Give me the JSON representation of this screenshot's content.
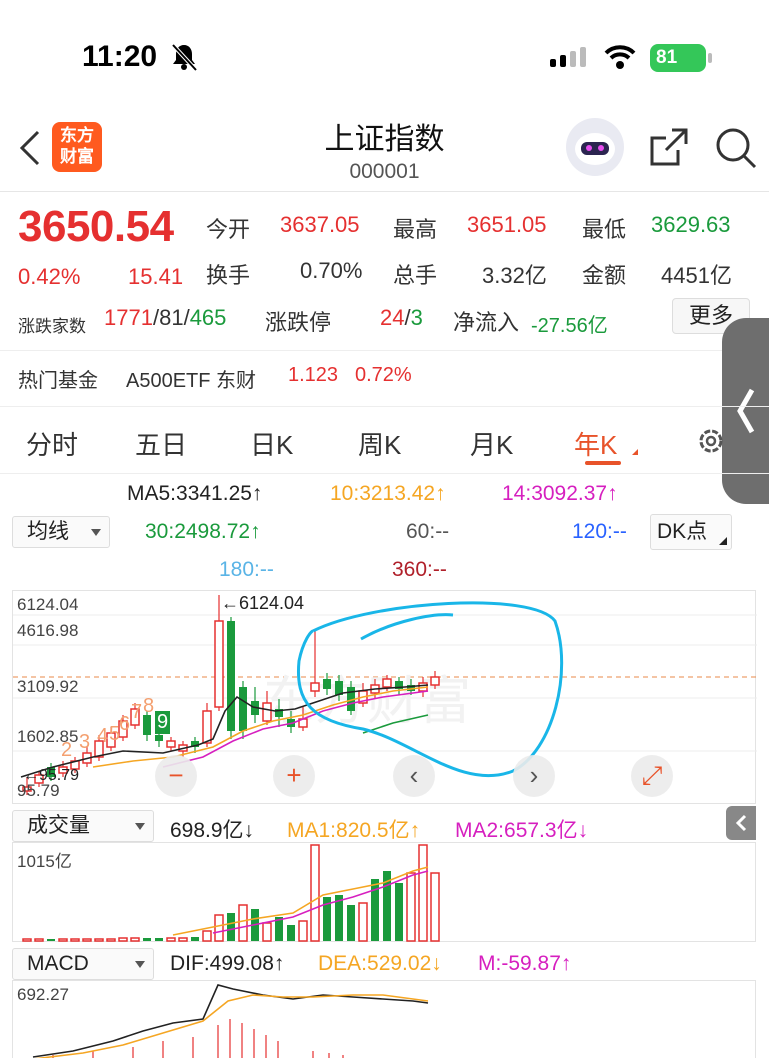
{
  "status_bar": {
    "time": "11:20",
    "battery": "81"
  },
  "nav": {
    "logo_line1": "东方",
    "logo_line2": "财富",
    "title": "上证指数",
    "code": "000001"
  },
  "quote": {
    "price": "3650.54",
    "change_pct": "0.42%",
    "change": "15.41",
    "open_label": "今开",
    "open": "3637.05",
    "high_label": "最高",
    "high": "3651.05",
    "low_label": "最低",
    "low": "3629.63",
    "turnover_label": "换手",
    "turnover": "0.70%",
    "volume_label": "总手",
    "volume": "3.32亿",
    "amount_label": "金额",
    "amount": "4451亿",
    "breadth_label": "涨跌家数",
    "breadth_up": "1771",
    "sep1": "/",
    "breadth_flat": "81",
    "sep2": "/",
    "breadth_down": "465",
    "limit_label": "涨跌停",
    "limit_up": "24",
    "sep3": "/",
    "limit_down": "3",
    "netflow_label": "净流入",
    "netflow": "-27.56亿",
    "more": "更多",
    "fund_label": "热门基金",
    "fund_name": "A500ETF 东财",
    "fund_price": "1.123",
    "fund_pct": "0.72%"
  },
  "tabs": [
    "分时",
    "五日",
    "日K",
    "周K",
    "月K",
    "年K"
  ],
  "active_tab": 5,
  "ma": {
    "ma5": "MA5:3341.25↑",
    "ma10": "10:3213.42↑",
    "ma14": "14:3092.37↑",
    "ma30": "30:2498.72↑",
    "ma60": "60:--",
    "ma120": "120:--",
    "ma180": "180:--",
    "ma360": "360:--",
    "select": "均线",
    "dk": "DK点"
  },
  "kline": {
    "y_labels": [
      "6124.04",
      "4616.98",
      "3109.92",
      "1602.85",
      "95.79"
    ],
    "max_label": "←6124.04",
    "min_label": "←95.79",
    "nine_numbers": [
      "2",
      "3",
      "4",
      "5",
      "6",
      "7",
      "8",
      "9"
    ],
    "controls": [
      "−",
      "+",
      "‹",
      "›",
      "⤢"
    ],
    "watermark": "东方财富"
  },
  "volume": {
    "select": "成交量",
    "value": "698.9亿↓",
    "ma1": "MA1:820.5亿↑",
    "ma2": "MA2:657.3亿↓",
    "axis": "1015亿"
  },
  "macd": {
    "select": "MACD",
    "dif": "DIF:499.08↑",
    "dea": "DEA:529.02↓",
    "m": "M:-59.87↑",
    "axis": "692.27"
  },
  "colors": {
    "up": "#e53030",
    "down": "#1a9a3c",
    "accent": "#e8532a",
    "ma10": "#f5a623",
    "ma14": "#d61fbf",
    "ma120": "#2962ff",
    "ma180": "#5ab4e6",
    "ma360": "#b0202a",
    "annotation": "#19b6e8"
  }
}
